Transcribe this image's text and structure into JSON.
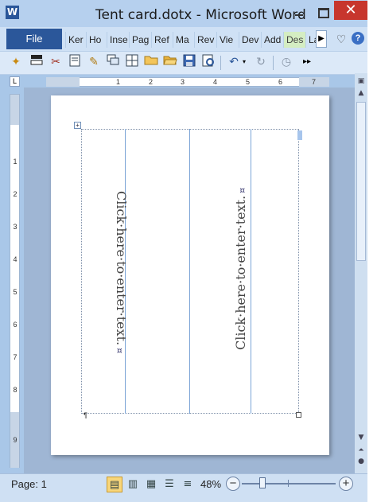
{
  "window": {
    "title": "Tent card.dotx - Microsoft Word",
    "app_icon_letter": "W",
    "close_glyph": "✕"
  },
  "ribbon": {
    "file_tab": "File",
    "tabs": [
      {
        "label": "Ker"
      },
      {
        "label": "Ho"
      },
      {
        "label": "Inse"
      },
      {
        "label": "Pag"
      },
      {
        "label": "Ref"
      },
      {
        "label": "Ma"
      },
      {
        "label": "Rev"
      },
      {
        "label": "Vie"
      },
      {
        "label": "Dev"
      },
      {
        "label": "Add"
      },
      {
        "label": "Des"
      },
      {
        "label": "La"
      }
    ],
    "scroll_glyph": "▶",
    "help_glyph": "?",
    "heart_glyph": "♡"
  },
  "toolbar": {
    "items": [
      "wand-icon",
      "bar-icon",
      "tools-icon",
      "page-icon",
      "edit-page-icon",
      "window-icon",
      "grid-icon",
      "folder-icon",
      "open-folder-icon",
      "save-icon",
      "print-preview-icon",
      "undo-icon",
      "redo-icon",
      "clock-icon",
      "more-icon"
    ]
  },
  "ruler": {
    "corner_glyph": "L",
    "h_numbers": [
      "1",
      "2",
      "3",
      "4",
      "5",
      "6",
      "7"
    ],
    "v_numbers": [
      "1",
      "2",
      "3",
      "4",
      "5",
      "6",
      "7",
      "8",
      "9"
    ]
  },
  "document": {
    "placeholder_1": "Click·here·to·enter·text.",
    "placeholder_2": "Click·here·to·enter·text.",
    "cell_mark": "¤",
    "move_handle": "+",
    "para_mark": "¶"
  },
  "statusbar": {
    "page": "Page: 1",
    "zoom": "48%",
    "zoom_level_percent": 48,
    "minus": "−",
    "plus": "+"
  },
  "colors": {
    "file_tab": "#2b579a",
    "close_button": "#c7362d",
    "design_tab": "#d4edc2"
  }
}
